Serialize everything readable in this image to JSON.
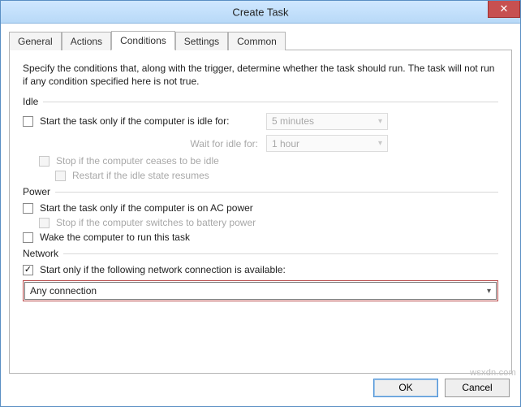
{
  "window": {
    "title": "Create Task",
    "close_glyph": "✕"
  },
  "tabs": {
    "items": [
      "General",
      "Actions",
      "Conditions",
      "Settings",
      "Common"
    ],
    "active_index": 2
  },
  "intro": "Specify the conditions that, along with the trigger, determine whether the task should run. The task will not run if any condition specified here is not true.",
  "groups": {
    "idle": {
      "label": "Idle",
      "start_if_idle": {
        "label": "Start the task only if the computer is idle for:",
        "checked": false
      },
      "idle_time": {
        "value": "5 minutes"
      },
      "wait_label": "Wait for idle for:",
      "wait_time": {
        "value": "1 hour"
      },
      "stop_if_ceases": {
        "label": "Stop if the computer ceases to be idle",
        "checked": false
      },
      "restart_if_resumes": {
        "label": "Restart if the idle state resumes",
        "checked": false
      }
    },
    "power": {
      "label": "Power",
      "only_ac": {
        "label": "Start the task only if the computer is on AC power",
        "checked": false
      },
      "stop_on_battery": {
        "label": "Stop if the computer switches to battery power",
        "checked": false
      },
      "wake": {
        "label": "Wake the computer to run this task",
        "checked": false
      }
    },
    "network": {
      "label": "Network",
      "only_if_network": {
        "label": "Start only if the following network connection is available:",
        "checked": true
      },
      "connection": {
        "value": "Any connection"
      }
    }
  },
  "buttons": {
    "ok": "OK",
    "cancel": "Cancel"
  },
  "watermark": "wsxdn.com"
}
